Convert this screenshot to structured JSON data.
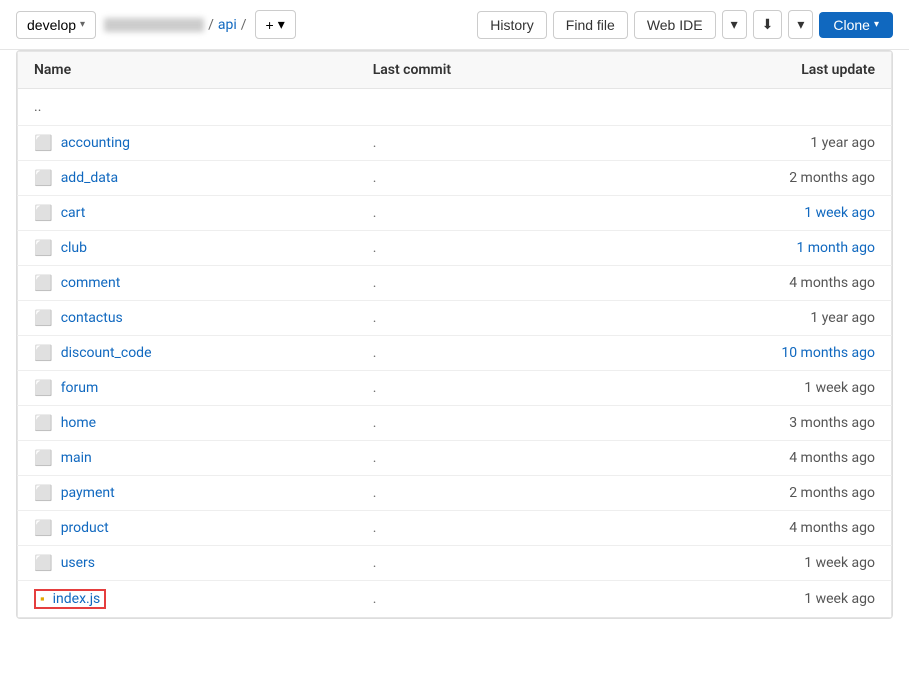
{
  "toolbar": {
    "branch": "develop",
    "breadcrumb": [
      "api"
    ],
    "add_label": "+",
    "history_label": "History",
    "find_file_label": "Find file",
    "web_ide_label": "Web IDE",
    "clone_label": "Clone"
  },
  "table": {
    "columns": {
      "name": "Name",
      "last_commit": "Last commit",
      "last_update": "Last update"
    },
    "parent_dir": "..",
    "rows": [
      {
        "type": "folder",
        "name": "accounting",
        "commit": ".",
        "update": "1 year ago",
        "update_blue": false
      },
      {
        "type": "folder",
        "name": "add_data",
        "commit": ".",
        "update": "2 months ago",
        "update_blue": false
      },
      {
        "type": "folder",
        "name": "cart",
        "commit": ".",
        "update": "1 week ago",
        "update_blue": true
      },
      {
        "type": "folder",
        "name": "club",
        "commit": ".",
        "update": "1 month ago",
        "update_blue": true
      },
      {
        "type": "folder",
        "name": "comment",
        "commit": ".",
        "update": "4 months ago",
        "update_blue": false
      },
      {
        "type": "folder",
        "name": "contactus",
        "commit": ".",
        "update": "1 year ago",
        "update_blue": false
      },
      {
        "type": "folder",
        "name": "discount_code",
        "commit": ".",
        "update": "10 months ago",
        "update_blue": true
      },
      {
        "type": "folder",
        "name": "forum",
        "commit": ".",
        "update": "1 week ago",
        "update_blue": false
      },
      {
        "type": "folder",
        "name": "home",
        "commit": ".",
        "update": "3 months ago",
        "update_blue": false
      },
      {
        "type": "folder",
        "name": "main",
        "commit": ".",
        "update": "4 months ago",
        "update_blue": false
      },
      {
        "type": "folder",
        "name": "payment",
        "commit": ".",
        "update": "2 months ago",
        "update_blue": false
      },
      {
        "type": "folder",
        "name": "product",
        "commit": ".",
        "update": "4 months ago",
        "update_blue": false
      },
      {
        "type": "folder",
        "name": "users",
        "commit": ".",
        "update": "1 week ago",
        "update_blue": false
      },
      {
        "type": "file",
        "name": "index.js",
        "commit": ".",
        "update": "1 week ago",
        "update_blue": false,
        "highlighted": true
      }
    ]
  }
}
